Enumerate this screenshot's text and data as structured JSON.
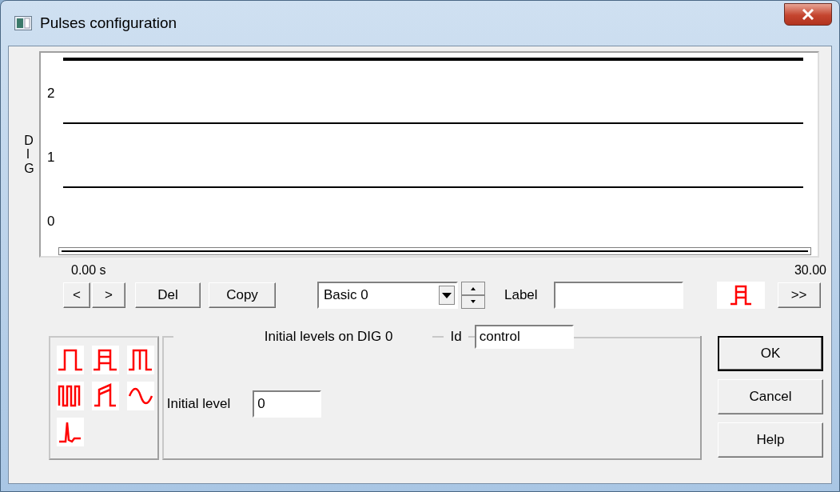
{
  "window": {
    "title": "Pulses configuration"
  },
  "plot": {
    "axis_label": "DIG",
    "channels": [
      {
        "label": "2",
        "selected": false
      },
      {
        "label": "1",
        "selected": false
      },
      {
        "label": "0",
        "selected": true
      }
    ],
    "time_start": "0.00 s",
    "time_end": "30.00"
  },
  "toolbar": {
    "nav_buttons": [
      "<",
      ">"
    ],
    "edit_buttons": [
      "Del",
      "Copy"
    ],
    "sequence": "Basic 0",
    "label_caption": "Label",
    "more_button": ">>"
  },
  "levels_group": {
    "title": "Initial levels on DIG 0",
    "id_label": "Id",
    "id_value": "control",
    "field_label": "Initial level",
    "field_value": "0"
  },
  "dialog_buttons": [
    {
      "label": "OK",
      "default": true
    },
    {
      "label": "Cancel",
      "default": false
    },
    {
      "label": "Help",
      "default": false
    }
  ]
}
